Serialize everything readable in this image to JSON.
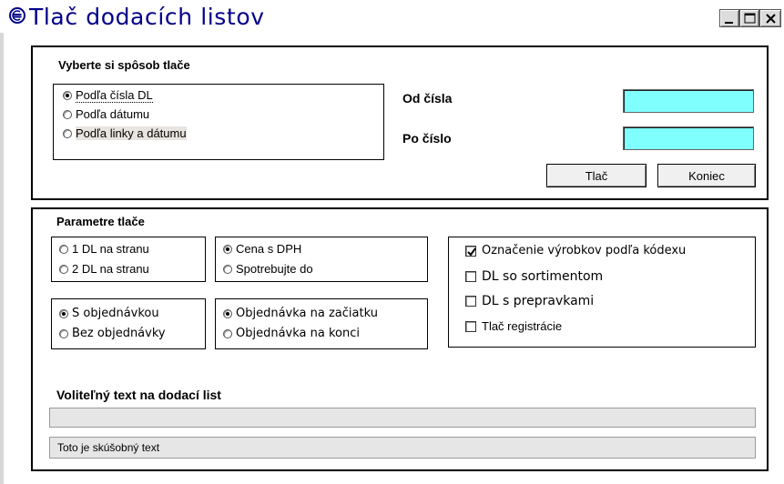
{
  "window": {
    "title": "Tlač dodacích listov",
    "buttons": [
      "minimize-icon",
      "maximize-icon",
      "close-icon"
    ]
  },
  "print_method": {
    "group_label": "Vyberte si spôsob tlače",
    "options": [
      {
        "label": "Podľa čísla DL",
        "selected": true
      },
      {
        "label": "Podľa dátumu",
        "selected": false
      },
      {
        "label": "Podľa linky a dátumu",
        "selected": false
      }
    ],
    "from_label": "Od čísla",
    "from_value": "",
    "to_label": "Po číslo",
    "to_value": "",
    "print_button": "Tlač",
    "end_button": "Koniec"
  },
  "params": {
    "group_label": "Parametre tlače",
    "per_page": [
      {
        "label": "1 DL na stranu",
        "selected": false
      },
      {
        "label": "2 DL na stranu",
        "selected": false
      }
    ],
    "price": [
      {
        "label": "Cena s DPH",
        "selected": true
      },
      {
        "label": "Spotrebujte do",
        "selected": false
      }
    ],
    "order": [
      {
        "label": "S objednávkou",
        "selected": true
      },
      {
        "label": "Bez objednávky",
        "selected": false
      }
    ],
    "order_position": [
      {
        "label": "Objednávka na začiatku",
        "selected": true
      },
      {
        "label": "Objednávka na konci",
        "selected": false
      }
    ],
    "checks": [
      {
        "label": "Označenie výrobkov podľa kódexu",
        "checked": true
      },
      {
        "label": "DL so sortimentom",
        "checked": false
      },
      {
        "label": "DL s prepravkami",
        "checked": false
      },
      {
        "label": "Tlač registrácie",
        "checked": false
      }
    ],
    "optional_text_label": "Voliteľný text na dodací list",
    "optional_text_value": "",
    "sample_text": "Toto je skúšobný text"
  }
}
